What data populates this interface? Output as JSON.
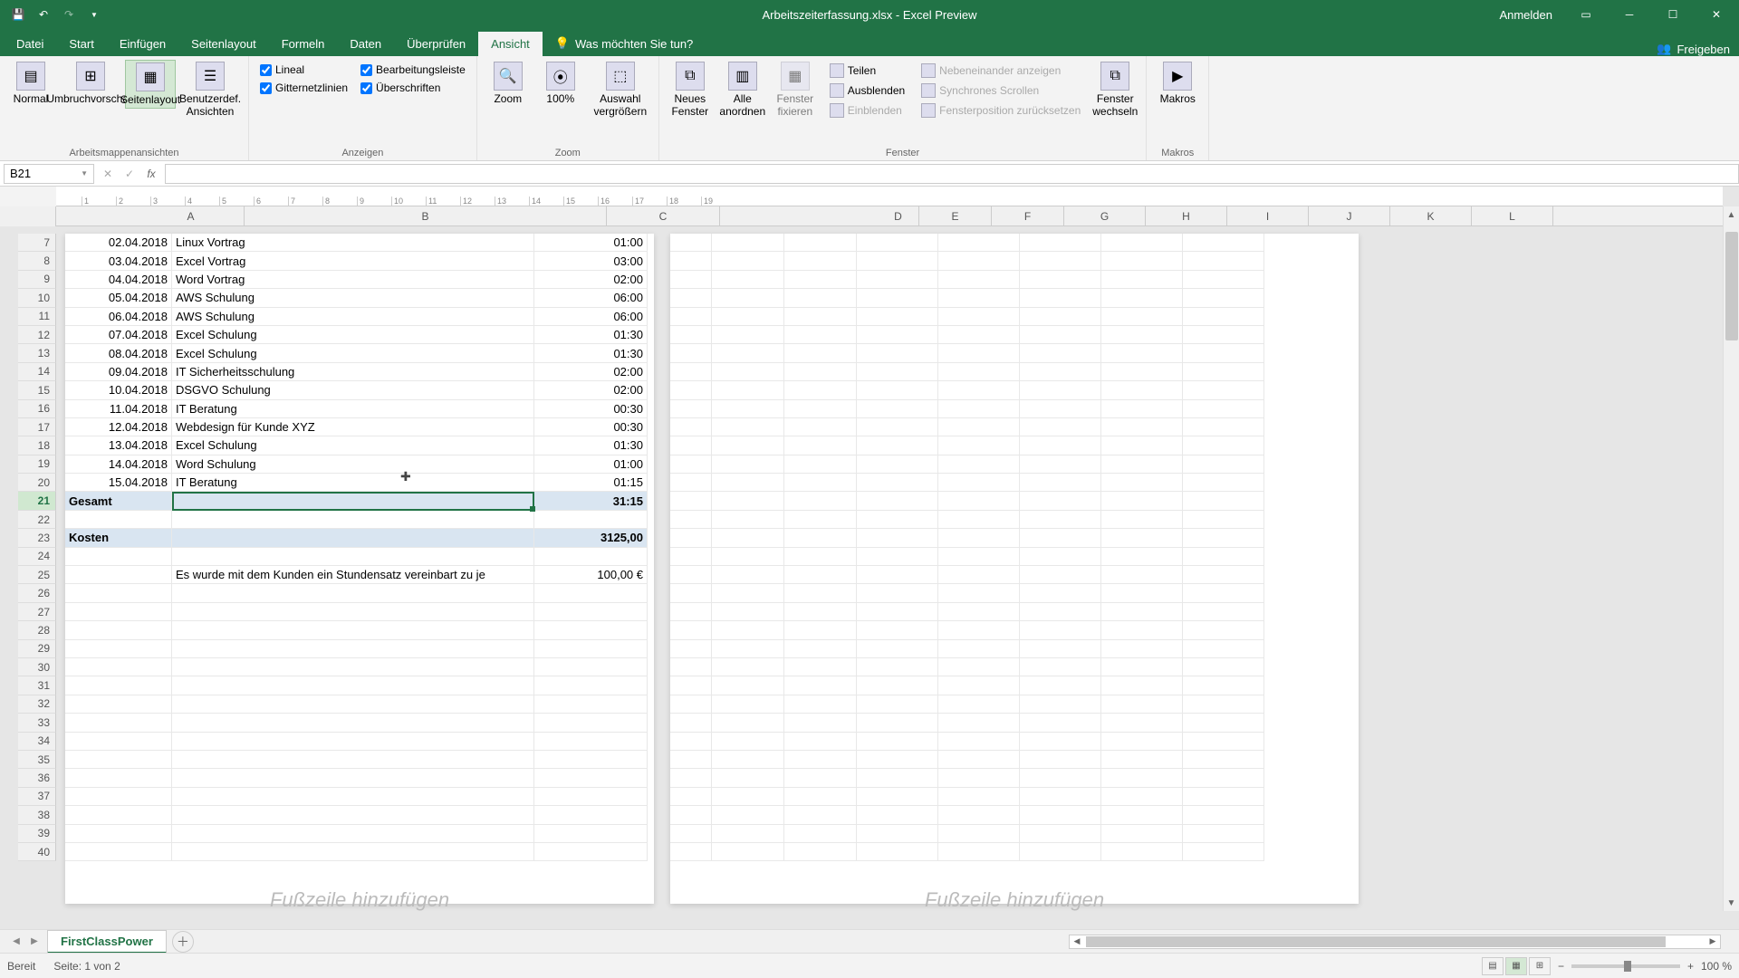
{
  "title": "Arbeitszeiterfassung.xlsx - Excel Preview",
  "signin": "Anmelden",
  "tabs": {
    "datei": "Datei",
    "start": "Start",
    "einfuegen": "Einfügen",
    "seitenlayout": "Seitenlayout",
    "formeln": "Formeln",
    "daten": "Daten",
    "ueberpruefen": "Überprüfen",
    "ansicht": "Ansicht",
    "tellme": "Was möchten Sie tun?"
  },
  "share": "Freigeben",
  "ribbon": {
    "views_group": "Arbeitsmappenansichten",
    "show_group": "Anzeigen",
    "zoom_group": "Zoom",
    "window_group": "Fenster",
    "macros_group": "Makros",
    "normal": "Normal",
    "umbruch": "Umbruchvorschau",
    "seitenlayout": "Seitenlayout",
    "benutzer": "Benutzerdef. Ansichten",
    "lineal": "Lineal",
    "bearbeitungsleiste": "Bearbeitungsleiste",
    "gitternetz": "Gitternetzlinien",
    "ueberschriften": "Überschriften",
    "zoom": "Zoom",
    "hundred": "100%",
    "auswahl": "Auswahl vergrößern",
    "neues_fenster": "Neues Fenster",
    "alle_anordnen": "Alle anordnen",
    "fixieren": "Fenster fixieren",
    "teilen": "Teilen",
    "ausblenden": "Ausblenden",
    "einblenden": "Einblenden",
    "nebeneinander": "Nebeneinander anzeigen",
    "synchron": "Synchrones Scrollen",
    "fensterpos": "Fensterposition zurücksetzen",
    "fenster_wechseln": "Fenster wechseln",
    "makros": "Makros"
  },
  "namebox": "B21",
  "cols": [
    "A",
    "B",
    "C",
    "D",
    "E",
    "F",
    "G",
    "H",
    "I",
    "J",
    "K",
    "L"
  ],
  "ruler": [
    "1",
    "2",
    "3",
    "4",
    "5",
    "6",
    "7",
    "8",
    "9",
    "10",
    "11",
    "12",
    "13",
    "14",
    "15",
    "16",
    "17",
    "18",
    "19"
  ],
  "rows_start": 7,
  "data_rows": [
    {
      "date": "02.04.2018",
      "desc": "Linux Vortrag",
      "time": "01:00"
    },
    {
      "date": "03.04.2018",
      "desc": "Excel Vortrag",
      "time": "03:00"
    },
    {
      "date": "04.04.2018",
      "desc": "Word Vortrag",
      "time": "02:00"
    },
    {
      "date": "05.04.2018",
      "desc": "AWS Schulung",
      "time": "06:00"
    },
    {
      "date": "06.04.2018",
      "desc": "AWS Schulung",
      "time": "06:00"
    },
    {
      "date": "07.04.2018",
      "desc": "Excel Schulung",
      "time": "01:30"
    },
    {
      "date": "08.04.2018",
      "desc": "Excel Schulung",
      "time": "01:30"
    },
    {
      "date": "09.04.2018",
      "desc": "IT Sicherheitsschulung",
      "time": "02:00"
    },
    {
      "date": "10.04.2018",
      "desc": "DSGVO Schulung",
      "time": "02:00"
    },
    {
      "date": "11.04.2018",
      "desc": "IT Beratung",
      "time": "00:30"
    },
    {
      "date": "12.04.2018",
      "desc": "Webdesign für Kunde XYZ",
      "time": "00:30"
    },
    {
      "date": "13.04.2018",
      "desc": "Excel Schulung",
      "time": "01:30"
    },
    {
      "date": "14.04.2018",
      "desc": "Word Schulung",
      "time": "01:00"
    },
    {
      "date": "15.04.2018",
      "desc": "IT Beratung",
      "time": "01:15"
    }
  ],
  "total_label": "Gesamt",
  "total_value": "31:15",
  "cost_label": "Kosten",
  "cost_value": "3125,00",
  "rate_note": "Es wurde mit dem Kunden ein Stundensatz vereinbart zu je",
  "rate_value": "100,00 €",
  "footer_placeholder": "Fußzeile hinzufügen",
  "sheet_name": "FirstClassPower",
  "status_ready": "Bereit",
  "status_page": "Seite: 1 von 2",
  "zoom_pct": "100 %"
}
